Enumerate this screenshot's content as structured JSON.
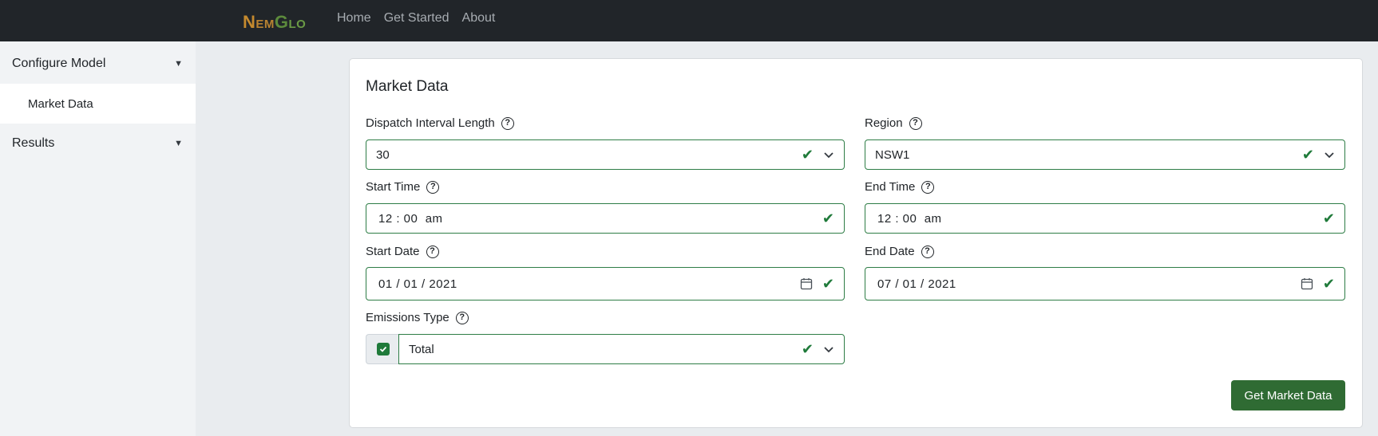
{
  "brand": {
    "n": "N",
    "em": "EM",
    "g": "G",
    "lo": "LO"
  },
  "nav": {
    "home": "Home",
    "get_started": "Get Started",
    "about": "About"
  },
  "sidebar": {
    "configure_model": "Configure Model",
    "market_data": "Market Data",
    "results": "Results"
  },
  "card": {
    "title": "Market Data"
  },
  "form": {
    "dispatch_interval": {
      "label": "Dispatch Interval Length",
      "value": "30"
    },
    "region": {
      "label": "Region",
      "value": "NSW1"
    },
    "start_time": {
      "label": "Start Time",
      "value": "12 : 00  am"
    },
    "end_time": {
      "label": "End Time",
      "value": "12 : 00  am"
    },
    "start_date": {
      "label": "Start Date",
      "value": "01 / 01 / 2021"
    },
    "end_date": {
      "label": "End Date",
      "value": "07 / 01 / 2021"
    },
    "emissions_type": {
      "label": "Emissions Type",
      "value": "Total",
      "checked": true
    }
  },
  "actions": {
    "get_market_data": "Get Market Data"
  },
  "icons": {
    "help": "?",
    "valid_check": "✔"
  },
  "colors": {
    "navbar": "#212529",
    "valid": "#1f7a3a",
    "button": "#2f6b33"
  }
}
